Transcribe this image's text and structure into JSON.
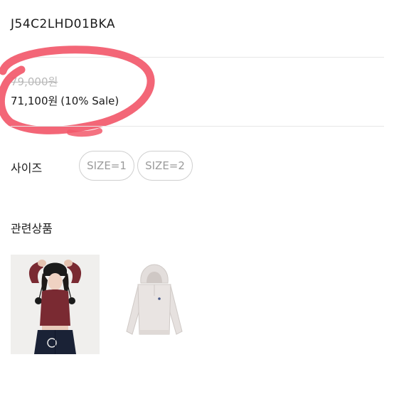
{
  "product": {
    "code": "J54C2LHD01BKA",
    "price_original": "79,000원",
    "price_sale": "71,100원",
    "sale_note": "(10% Sale)"
  },
  "size": {
    "label": "사이즈",
    "options": [
      "SIZE=1",
      "SIZE=2"
    ]
  },
  "related": {
    "label": "관련상품",
    "items": [
      {
        "icon": "model-wearing-crop-hoodie-photo"
      },
      {
        "icon": "light-gray-crop-hoodie-photo"
      }
    ]
  },
  "annotation": {
    "shape": "hand-drawn-circle",
    "color": "#f2596b"
  },
  "colors": {
    "text": "#1a1a1a",
    "muted": "#b9b9b9",
    "divider": "#e6e6e6",
    "chip_border": "#cfcfcf",
    "chip_text": "#9b9b9b"
  }
}
